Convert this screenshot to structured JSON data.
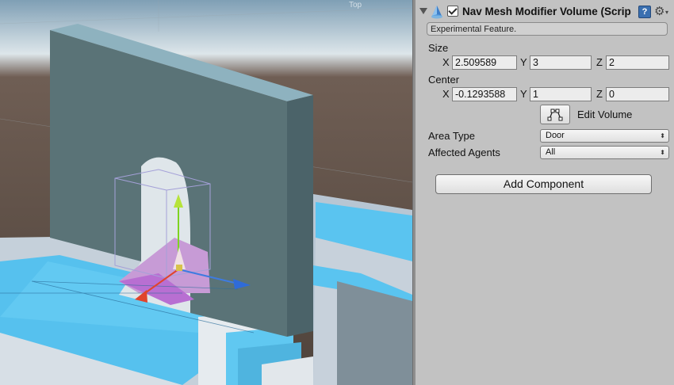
{
  "scene": {
    "gizmo_label": "Top"
  },
  "component": {
    "title": "Nav Mesh Modifier Volume (Scrip",
    "enabled": true,
    "info": "Experimental Feature."
  },
  "size": {
    "label": "Size",
    "x_axis": "X",
    "x_value": "2.509589",
    "y_axis": "Y",
    "y_value": "3",
    "z_axis": "Z",
    "z_value": "2"
  },
  "center": {
    "label": "Center",
    "x_axis": "X",
    "x_value": "-0.1293588",
    "y_axis": "Y",
    "y_value": "1",
    "z_axis": "Z",
    "z_value": "0"
  },
  "edit_volume": {
    "label": "Edit Volume"
  },
  "area_type": {
    "label": "Area Type",
    "value": "Door"
  },
  "affected_agents": {
    "label": "Affected Agents",
    "value": "All"
  },
  "add_component": {
    "label": "Add Component"
  },
  "icons": {
    "component": "nav-mesh-cone-icon",
    "help": "help-book-icon",
    "settings": "gear-icon",
    "edit": "edit-volume-icon"
  }
}
